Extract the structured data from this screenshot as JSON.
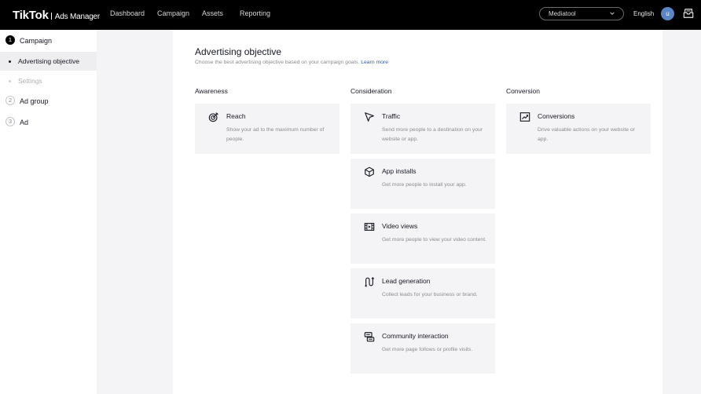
{
  "header": {
    "logo": "TikTok",
    "logo_sub": "Ads Manager",
    "nav": [
      "Dashboard",
      "Campaign",
      "Assets",
      "Reporting"
    ],
    "account": "Mediatool",
    "language": "English",
    "avatar_initial": "u"
  },
  "sidebar": {
    "steps": [
      {
        "num": "1",
        "label": "Campaign"
      },
      {
        "num": "2",
        "label": "Ad group"
      },
      {
        "num": "3",
        "label": "Ad"
      }
    ],
    "substeps": [
      {
        "label": "Advertising objective"
      },
      {
        "label": "Settings"
      }
    ]
  },
  "main": {
    "title": "Advertising objective",
    "subtitle": "Choose the best advertising objective based on your campaign goals.",
    "learn_more": "Learn more",
    "columns": [
      {
        "heading": "Awareness",
        "objectives": [
          {
            "name": "Reach",
            "desc": "Show your ad to the maximum number of people.",
            "icon": "target-icon"
          }
        ]
      },
      {
        "heading": "Consideration",
        "objectives": [
          {
            "name": "Traffic",
            "desc": "Send more people to a destination on your website or app.",
            "icon": "cursor-icon"
          },
          {
            "name": "App installs",
            "desc": "Get more people to install your app.",
            "icon": "cube-icon"
          },
          {
            "name": "Video views",
            "desc": "Get more people to view your video content.",
            "icon": "film-icon"
          },
          {
            "name": "Lead generation",
            "desc": "Collect leads for your business or brand.",
            "icon": "funnel-path-icon"
          },
          {
            "name": "Community interaction",
            "desc": "Get more page follows or profile visits.",
            "icon": "community-icon"
          }
        ]
      },
      {
        "heading": "Conversion",
        "objectives": [
          {
            "name": "Conversions",
            "desc": "Drive valuable actions on your website or app.",
            "icon": "trend-chart-icon"
          }
        ]
      }
    ]
  },
  "colors": {
    "topbar": "#000000",
    "link": "#2b5ccc",
    "card_bg": "#f4f4f6",
    "avatar": "#5a86c7"
  }
}
